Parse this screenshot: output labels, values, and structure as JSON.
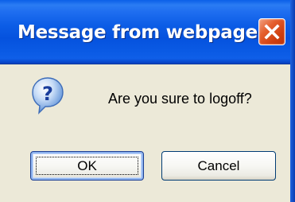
{
  "window": {
    "title": "Message from webpage"
  },
  "dialog": {
    "icon": "question-icon",
    "message": "Are you sure to logoff?"
  },
  "buttons": {
    "ok_label": "OK",
    "cancel_label": "Cancel"
  },
  "colors": {
    "titlebar": "#0a5ae4",
    "close_button": "#e5602f",
    "dialog_background": "#ece9d8",
    "default_button_border": "#1c3f94"
  }
}
